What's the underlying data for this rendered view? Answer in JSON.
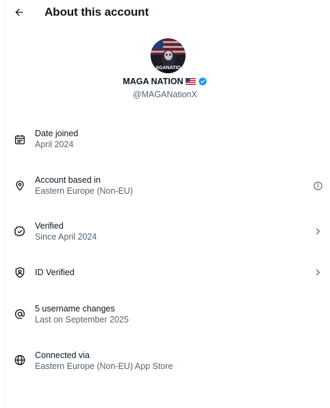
{
  "header": {
    "title": "About this account",
    "back_icon": "arrow-left-icon"
  },
  "profile": {
    "name": "MAGA NATION",
    "handle": "@MAGANationX",
    "avatar_text": "AGANATIO",
    "flag_icon": "us-flag-icon",
    "verified_icon": "verified-badge-icon",
    "verified_color": "#1d9bf0"
  },
  "rows": [
    {
      "icon": "calendar-icon",
      "label": "Date joined",
      "sub": "April 2024",
      "trailing": ""
    },
    {
      "icon": "location-pin-icon",
      "label": "Account based in",
      "sub": "Eastern Europe (Non-EU)",
      "trailing": "info-icon"
    },
    {
      "icon": "verified-check-icon",
      "label": "Verified",
      "sub": "Since April 2024",
      "trailing": "chevron-right-icon"
    },
    {
      "icon": "id-shield-icon",
      "label": "ID Verified",
      "sub": "",
      "trailing": "chevron-right-icon"
    },
    {
      "icon": "at-sign-icon",
      "label": "5 username changes",
      "sub": "Last on September 2025",
      "trailing": ""
    },
    {
      "icon": "globe-icon",
      "label": "Connected via",
      "sub": "Eastern Europe (Non-EU) App Store",
      "trailing": ""
    }
  ],
  "colors": {
    "text": "#0f1419",
    "secondary": "#536471",
    "accent": "#1d9bf0"
  }
}
